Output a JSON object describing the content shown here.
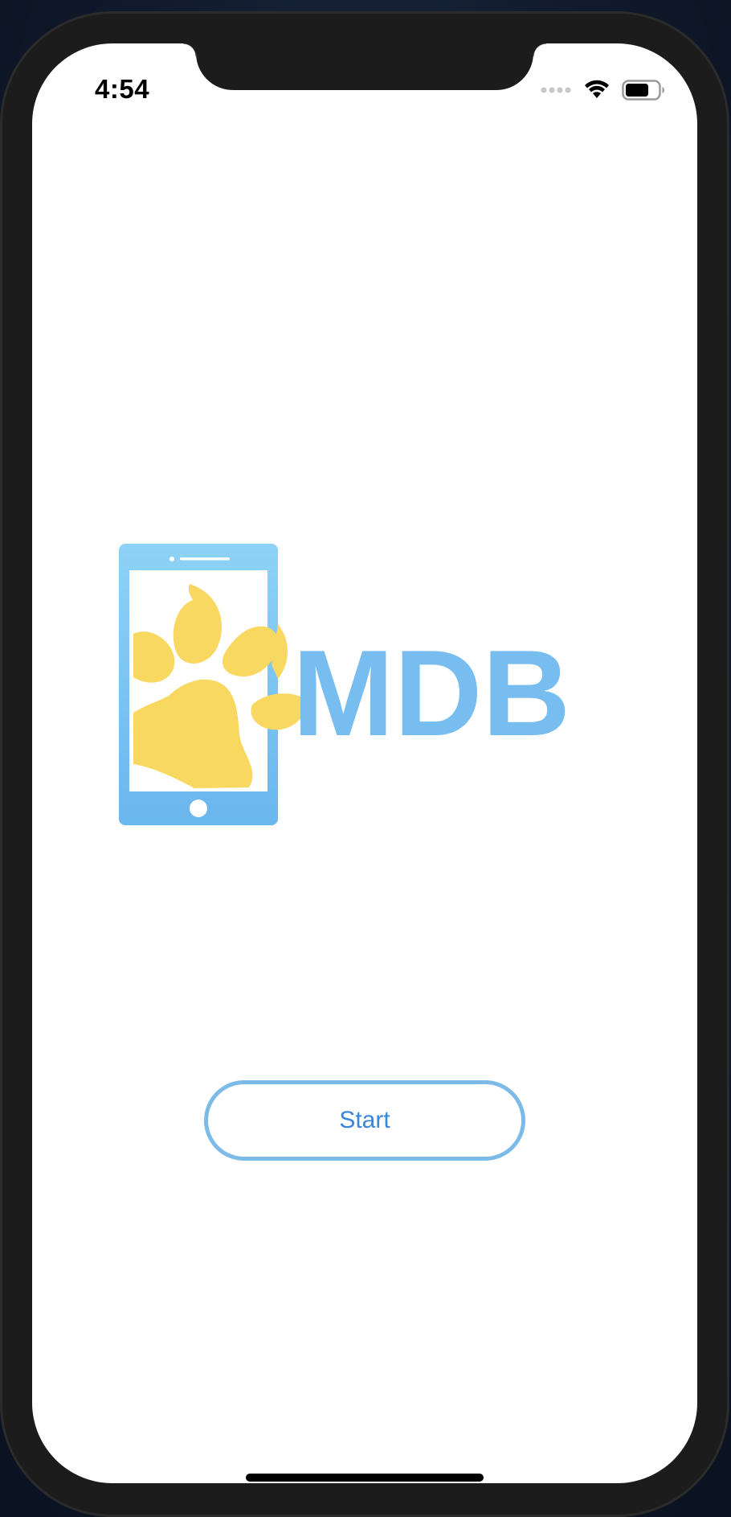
{
  "status_bar": {
    "time": "4:54",
    "signal_icon": "cellular-signal-icon",
    "wifi_icon": "wifi-icon",
    "battery_icon": "battery-icon"
  },
  "logo": {
    "wordmark": "MDB",
    "icon": "phone-paw-icon",
    "colors": {
      "primary_blue": "#78bdf0",
      "paw_yellow": "#f9d861"
    }
  },
  "start_button": {
    "label": "Start",
    "border_color": "#7cbbe8",
    "text_color": "#3a86d8"
  }
}
